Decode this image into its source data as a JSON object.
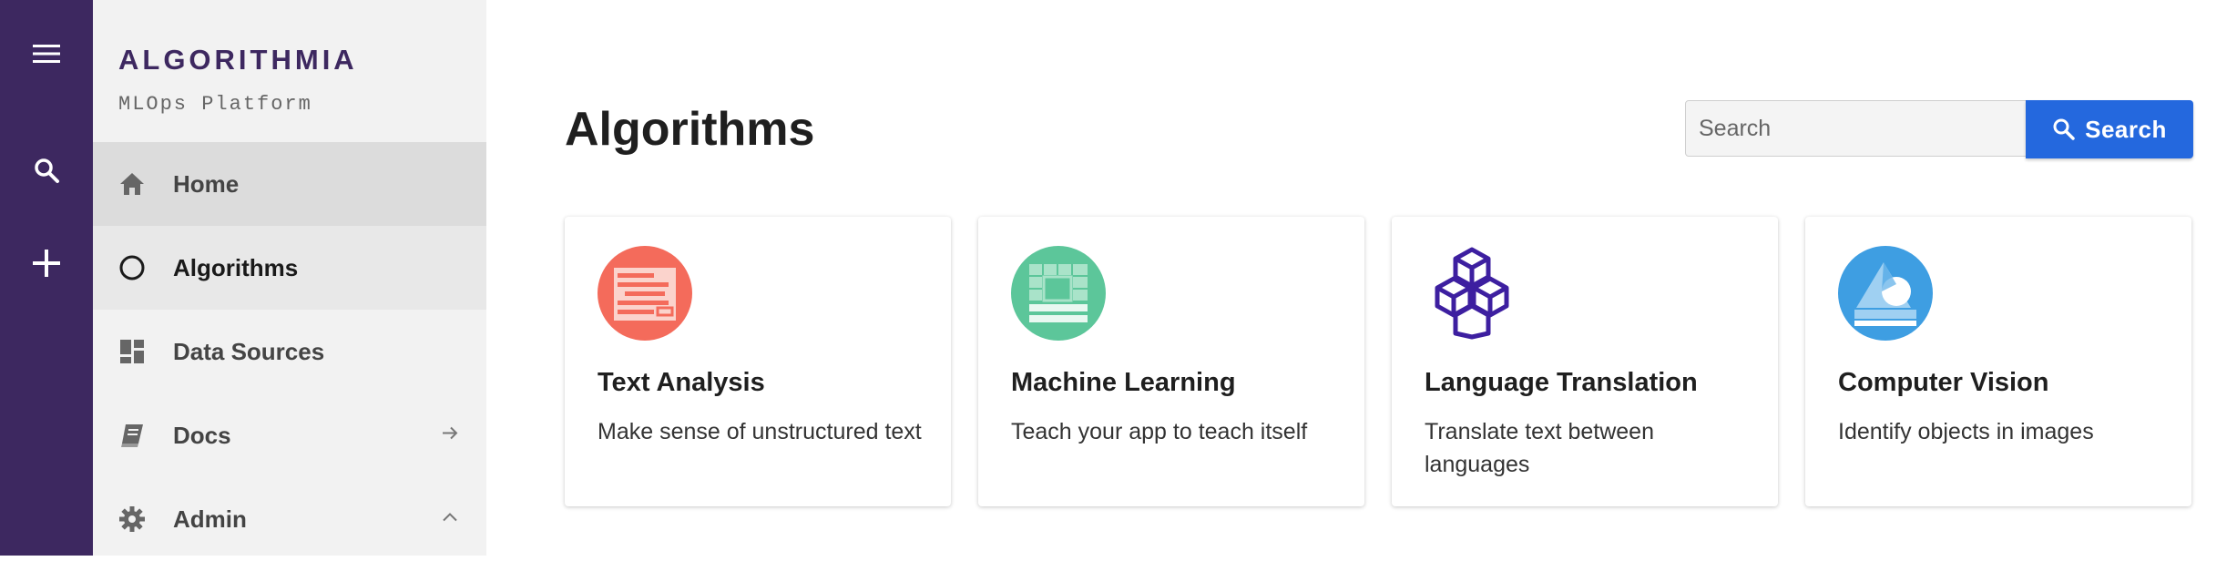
{
  "brand": {
    "name": "ALGORITHMIA",
    "subtitle": "MLOps Platform",
    "color": "#3d2860"
  },
  "rail": {
    "items": [
      "menu-icon",
      "search-icon",
      "plus-icon"
    ]
  },
  "sidebar": {
    "items": [
      {
        "label": "Home",
        "icon": "home-icon"
      },
      {
        "label": "Algorithms",
        "icon": "circle-icon"
      },
      {
        "label": "Data Sources",
        "icon": "dashboard-icon"
      },
      {
        "label": "Docs",
        "icon": "book-icon",
        "trail": "arrow-right-icon"
      },
      {
        "label": "Admin",
        "icon": "gear-icon",
        "trail": "chevron-up-icon"
      }
    ]
  },
  "main": {
    "title": "Algorithms",
    "search": {
      "placeholder": "Search",
      "button_label": "Search",
      "accent": "#2468de"
    },
    "cards": [
      {
        "title": "Text Analysis",
        "description": "Make sense of unstructured text",
        "icon": "text-analysis-icon",
        "color": "#f46b5b"
      },
      {
        "title": "Machine Learning",
        "description": "Teach your app to teach itself",
        "icon": "machine-learning-icon",
        "color": "#5cc69a"
      },
      {
        "title": "Language Translation",
        "description": "Translate text between languages",
        "icon": "language-translation-icon",
        "color": "#3d1fa0"
      },
      {
        "title": "Computer Vision",
        "description": "Identify objects in images",
        "icon": "computer-vision-icon",
        "color": "#3e9ee2"
      }
    ]
  }
}
